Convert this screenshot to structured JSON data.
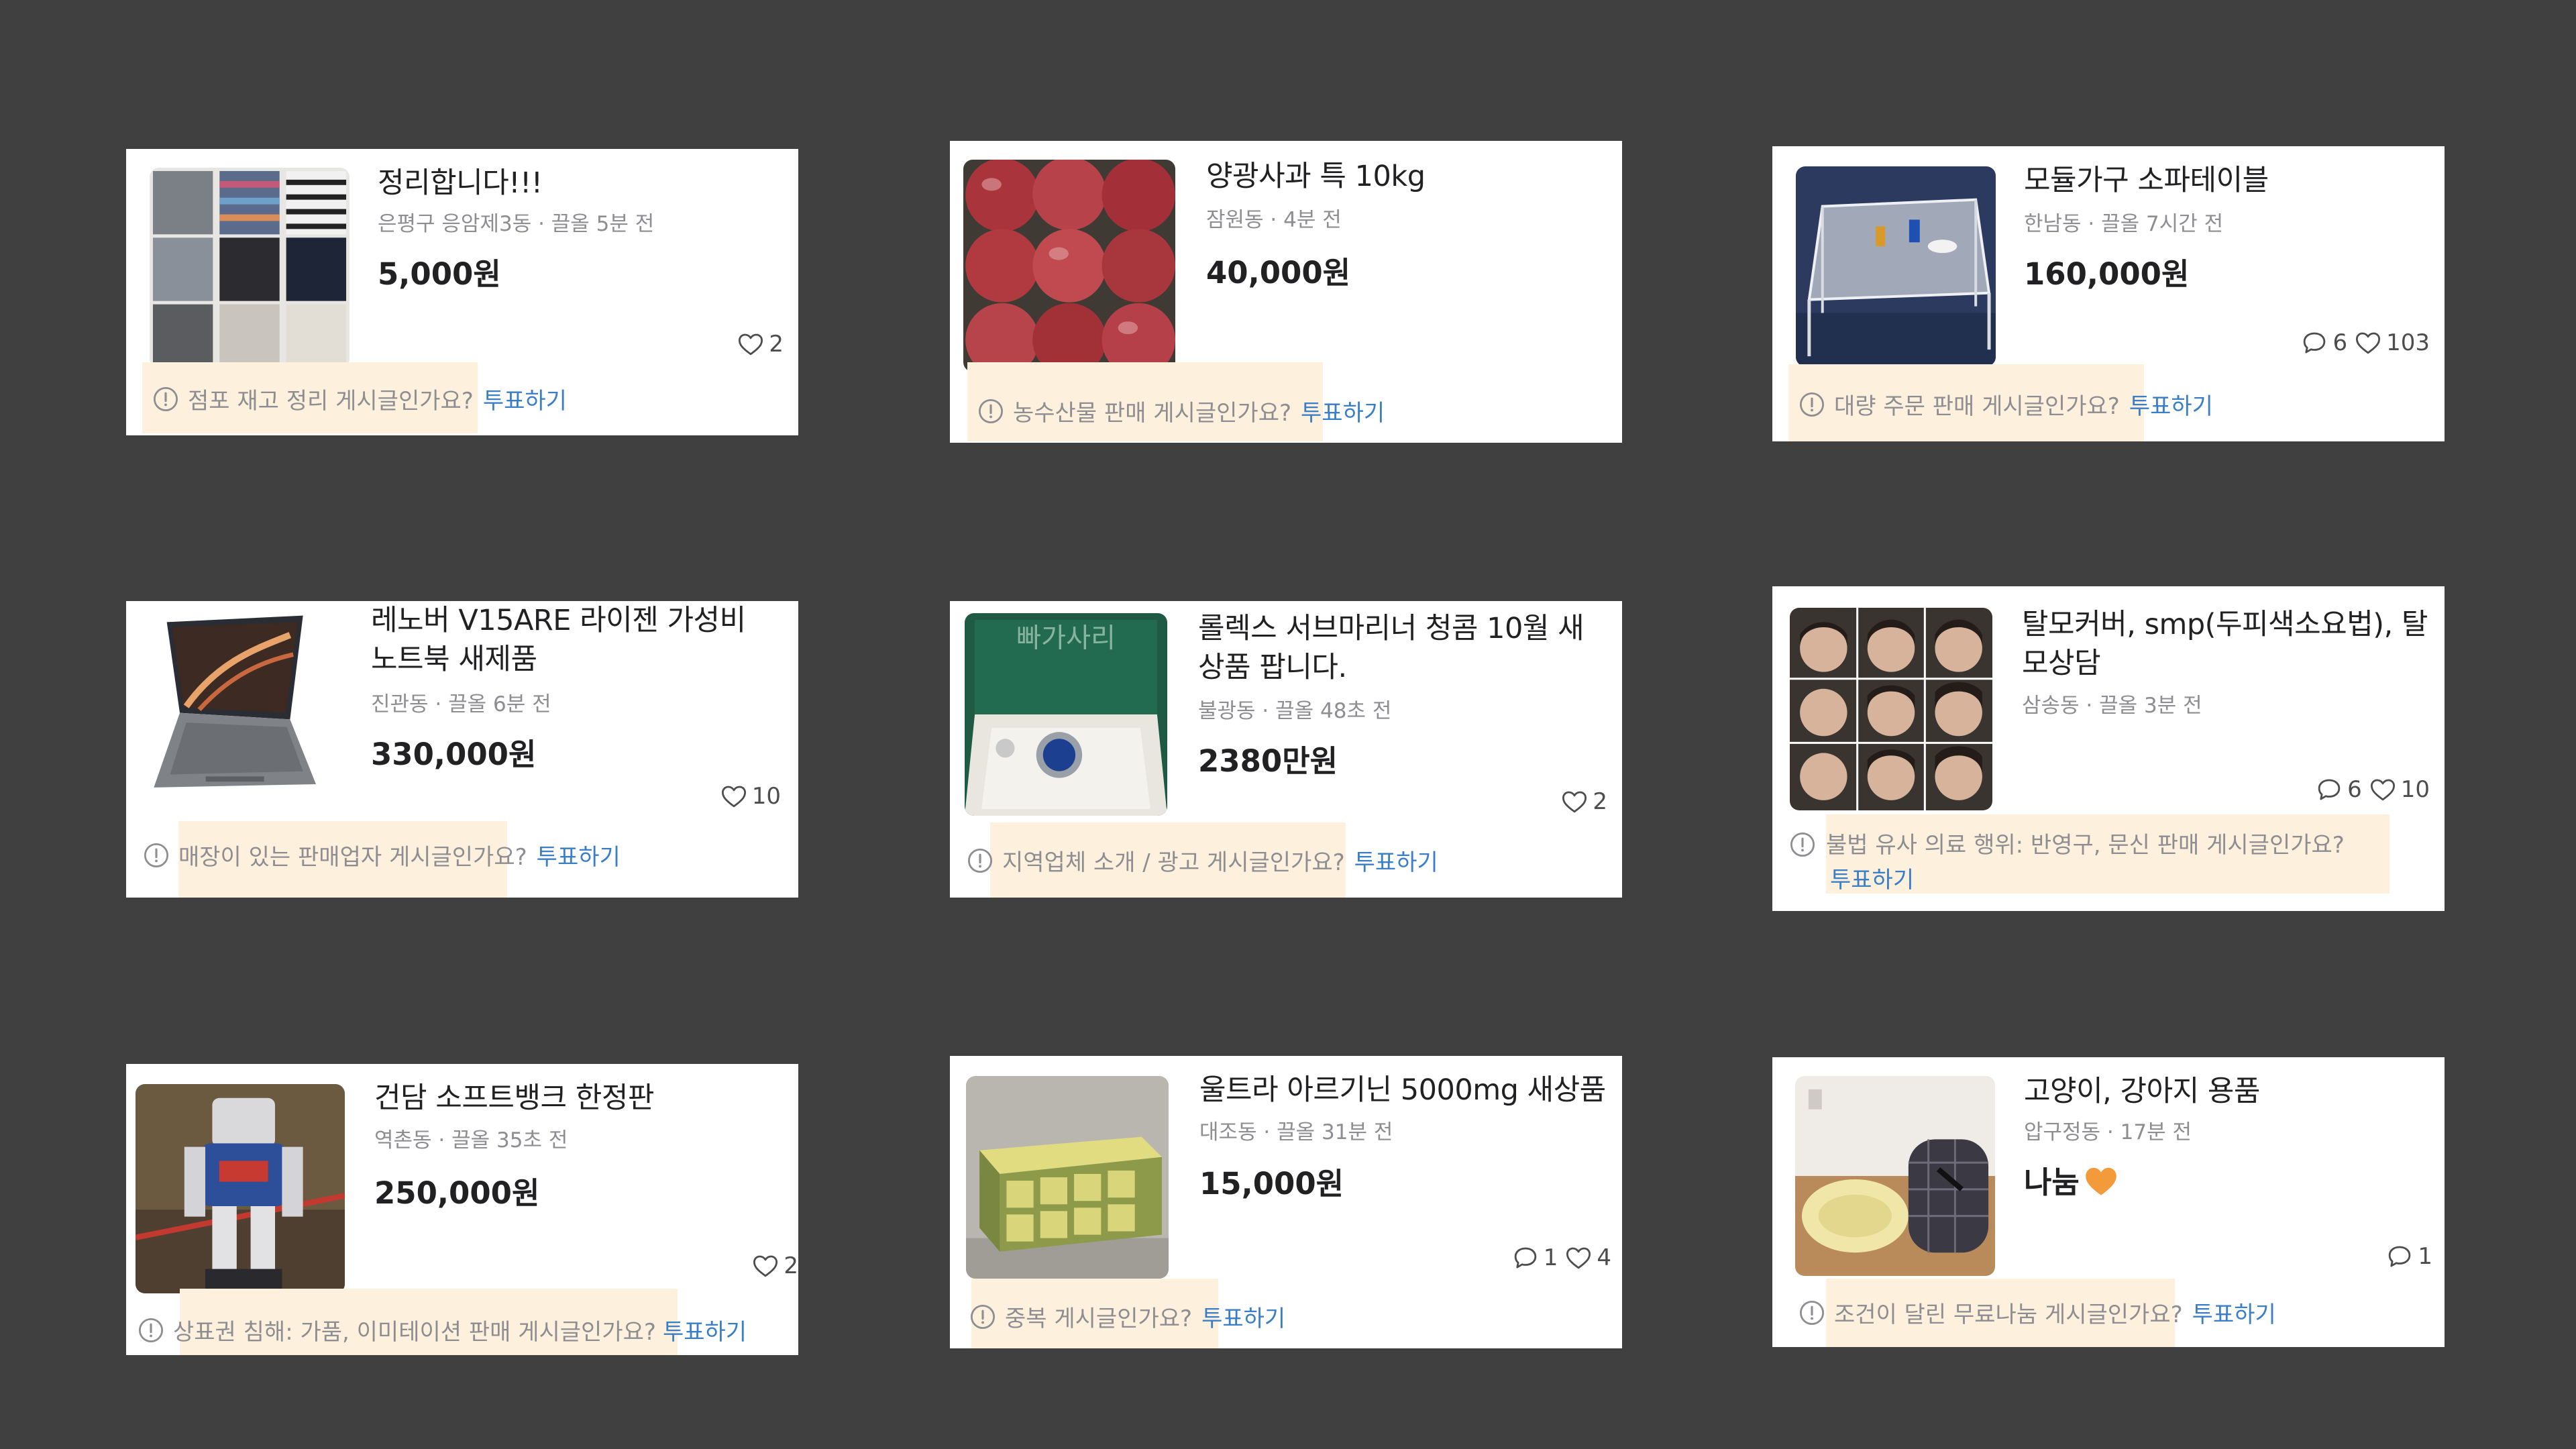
{
  "cards": [
    {
      "title": "정리합니다!!!",
      "meta": "은평구 응암제3동 · 끌올 5분 전",
      "price": "5,000원",
      "comments": "",
      "likes": "2",
      "question": "점포 재고 정리 게시글인가요?",
      "vote": "투표하기"
    },
    {
      "title": "양광사과 특 10kg",
      "meta": "잠원동 · 4분 전",
      "price": "40,000원",
      "comments": "",
      "likes": "",
      "question": "농수산물 판매 게시글인가요?",
      "vote": "투표하기"
    },
    {
      "title": "모듈가구 소파테이블",
      "meta": "한남동 · 끌올 7시간 전",
      "price": "160,000원",
      "comments": "6",
      "likes": "103",
      "question": "대량 주문 판매 게시글인가요?",
      "vote": "투표하기"
    },
    {
      "title": "레노버 V15ARE 라이젠 가성비 노트북 새제품",
      "meta": "진관동 · 끌올 6분 전",
      "price": "330,000원",
      "comments": "",
      "likes": "10",
      "question": "매장이 있는 판매업자 게시글인가요?",
      "vote": "투표하기"
    },
    {
      "title": "롤렉스 서브마리너 청콤 10월 새상품 팝니다.",
      "meta": "불광동 · 끌올 48초 전",
      "price": "2380만원",
      "comments": "",
      "likes": "2",
      "question": "지역업체 소개 / 광고 게시글인가요?",
      "vote": "투표하기",
      "image_text": "빠가사리"
    },
    {
      "title": "탈모커버, smp(두피색소요법), 탈모상담",
      "meta": "삼송동 · 끌올 3분 전",
      "price": "",
      "comments": "6",
      "likes": "10",
      "question": "불법 유사 의료 행위: 반영구, 문신 판매 게시글인가요?",
      "vote": "투표하기"
    },
    {
      "title": "건담 소프트뱅크 한정판",
      "meta": "역촌동 · 끌올 35초 전",
      "price": "250,000원",
      "comments": "",
      "likes": "2",
      "question": "상표권 침해: 가품, 이미테이션 판매 게시글인가요?",
      "vote": "투표하기"
    },
    {
      "title": "울트라 아르기닌 5000mg 새상품",
      "meta": "대조동 · 끌올 31분 전",
      "price": "15,000원",
      "comments": "1",
      "likes": "4",
      "question": "중복 게시글인가요?",
      "vote": "투표하기"
    },
    {
      "title": "고양이, 강아지 용품",
      "meta": "압구정동 · 17분 전",
      "price": "나눔",
      "comments": "1",
      "likes": "",
      "question": "조건이 달린 무료나눔 게시글인가요?",
      "vote": "투표하기"
    }
  ],
  "colors": {
    "background": "#404040",
    "card": "#ffffff",
    "highlight": "#fdf1dd",
    "vote": "#3a7ec7",
    "muted": "#8d8d92"
  },
  "icons": {
    "comment": "comment-icon",
    "like": "heart-icon",
    "warning": "warning-circle-icon",
    "share_heart": "orange-heart-icon"
  }
}
